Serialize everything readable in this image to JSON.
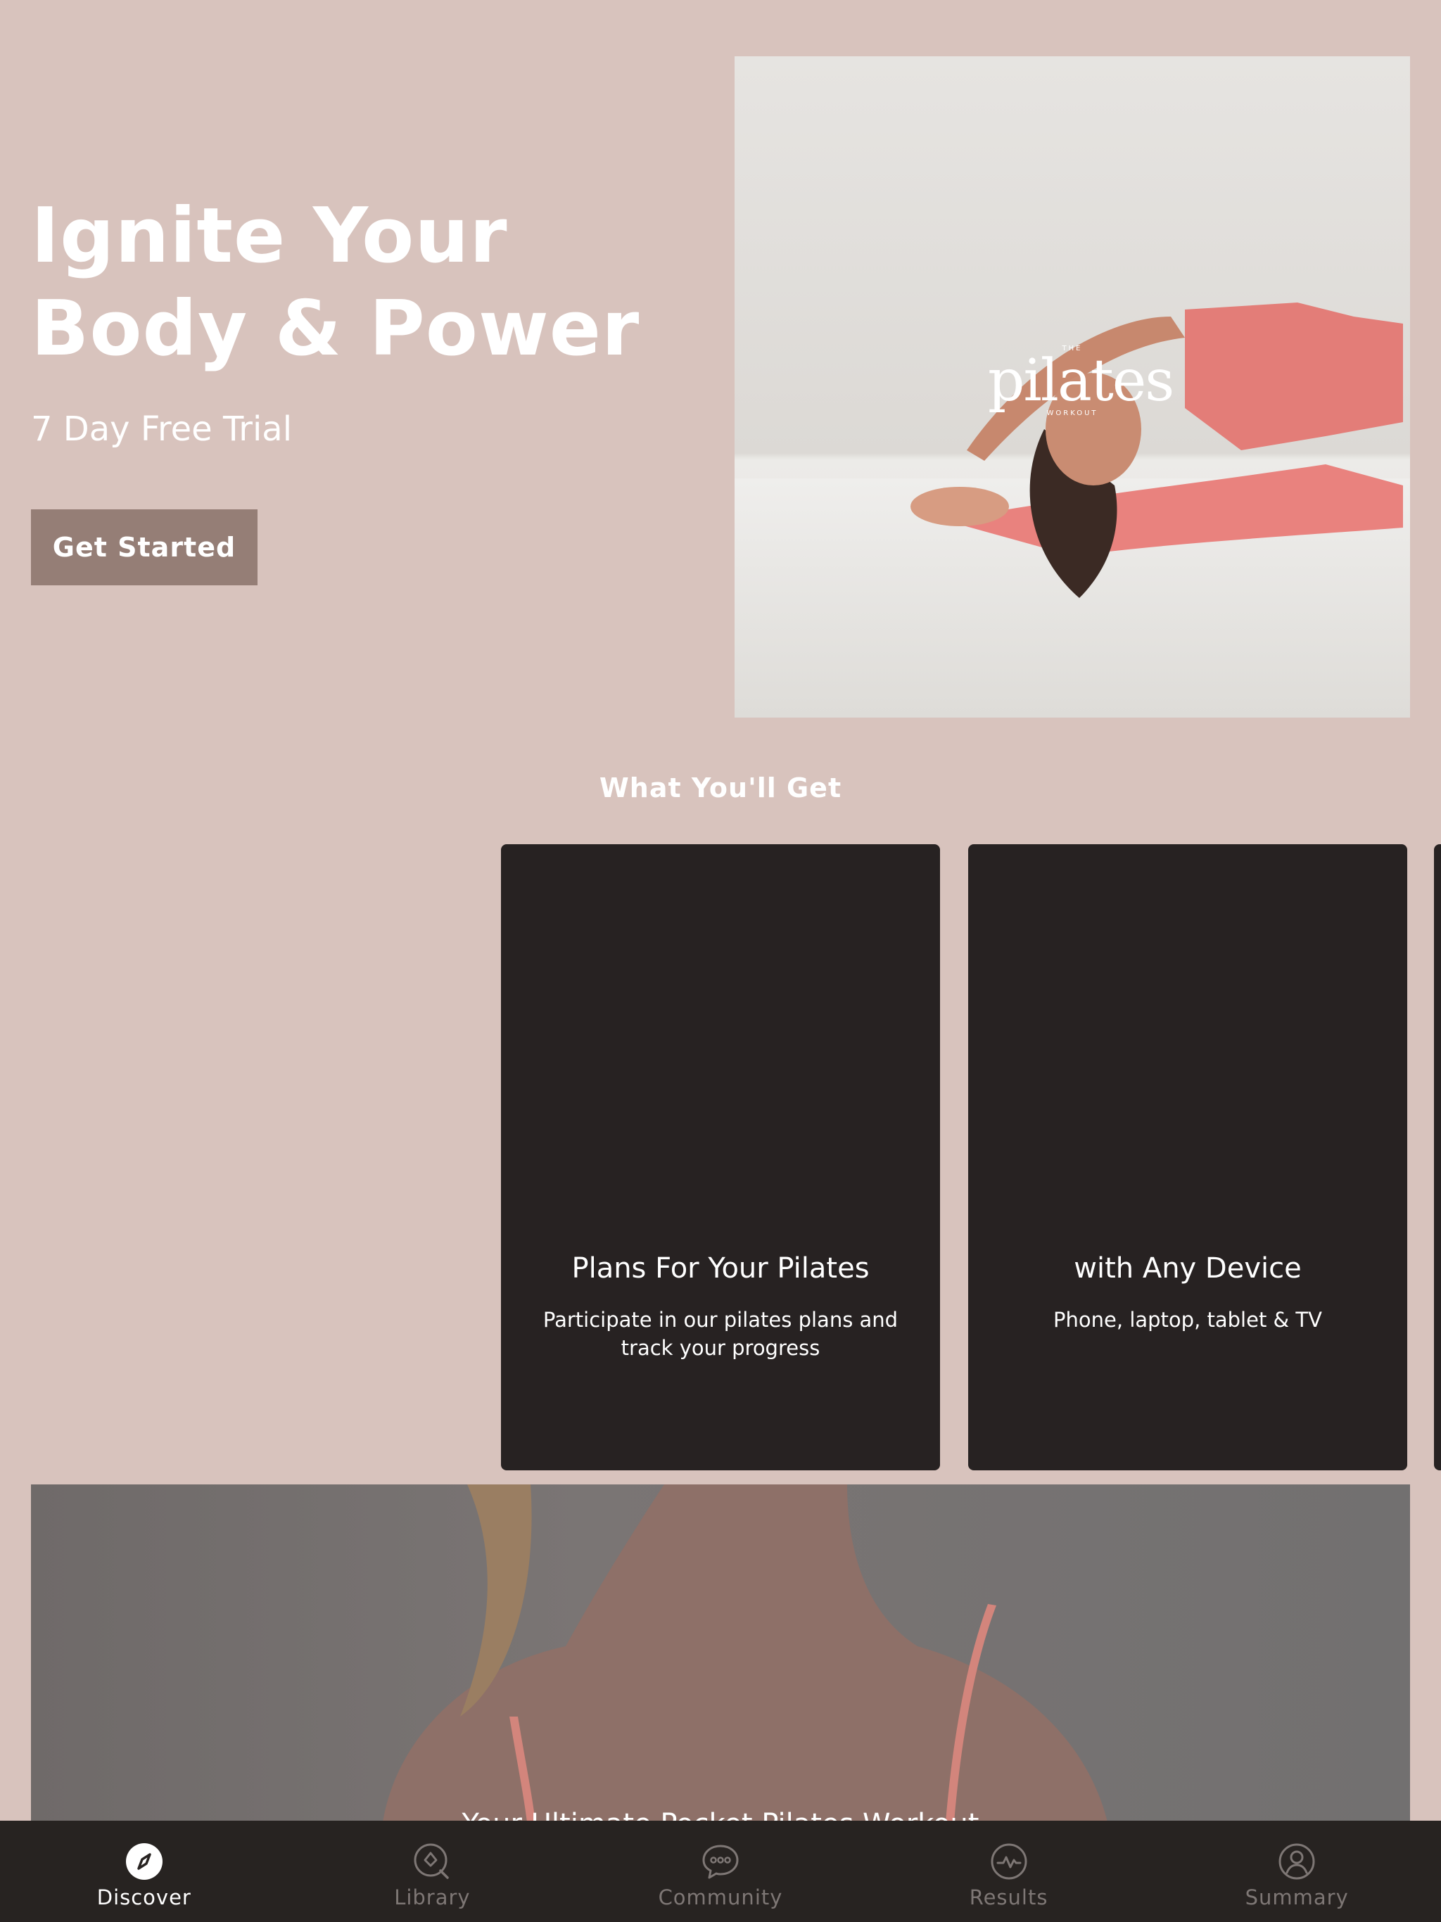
{
  "hero": {
    "title": "Ignite Your Body & Power",
    "subtitle": "7 Day Free Trial",
    "cta_label": "Get Started",
    "image_logo_small": "THE",
    "image_logo": "pilates",
    "image_logo_sub": "WORKOUT"
  },
  "section": {
    "title": "What You'll Get"
  },
  "cards": [
    {
      "title": "Plans For Your Pilates",
      "description": "Participate in our pilates plans and track your progress"
    },
    {
      "title": "with Any Device",
      "description": "Phone, laptop, tablet & TV"
    }
  ],
  "banner": {
    "caption": "Your Ultimate Pocket Pilates Workout"
  },
  "tabbar": {
    "items": [
      {
        "label": "Discover",
        "icon": "compass-icon",
        "active": true
      },
      {
        "label": "Library",
        "icon": "library-search-icon",
        "active": false
      },
      {
        "label": "Community",
        "icon": "chat-bubble-icon",
        "active": false
      },
      {
        "label": "Results",
        "icon": "activity-icon",
        "active": false
      },
      {
        "label": "Summary",
        "icon": "user-circle-icon",
        "active": false
      }
    ]
  },
  "colors": {
    "background": "#d8c3bd",
    "cta": "#957e76",
    "card": "#272222",
    "tabbar": "#272321",
    "tab_inactive": "#7e7775",
    "tab_active": "#ffffff"
  }
}
